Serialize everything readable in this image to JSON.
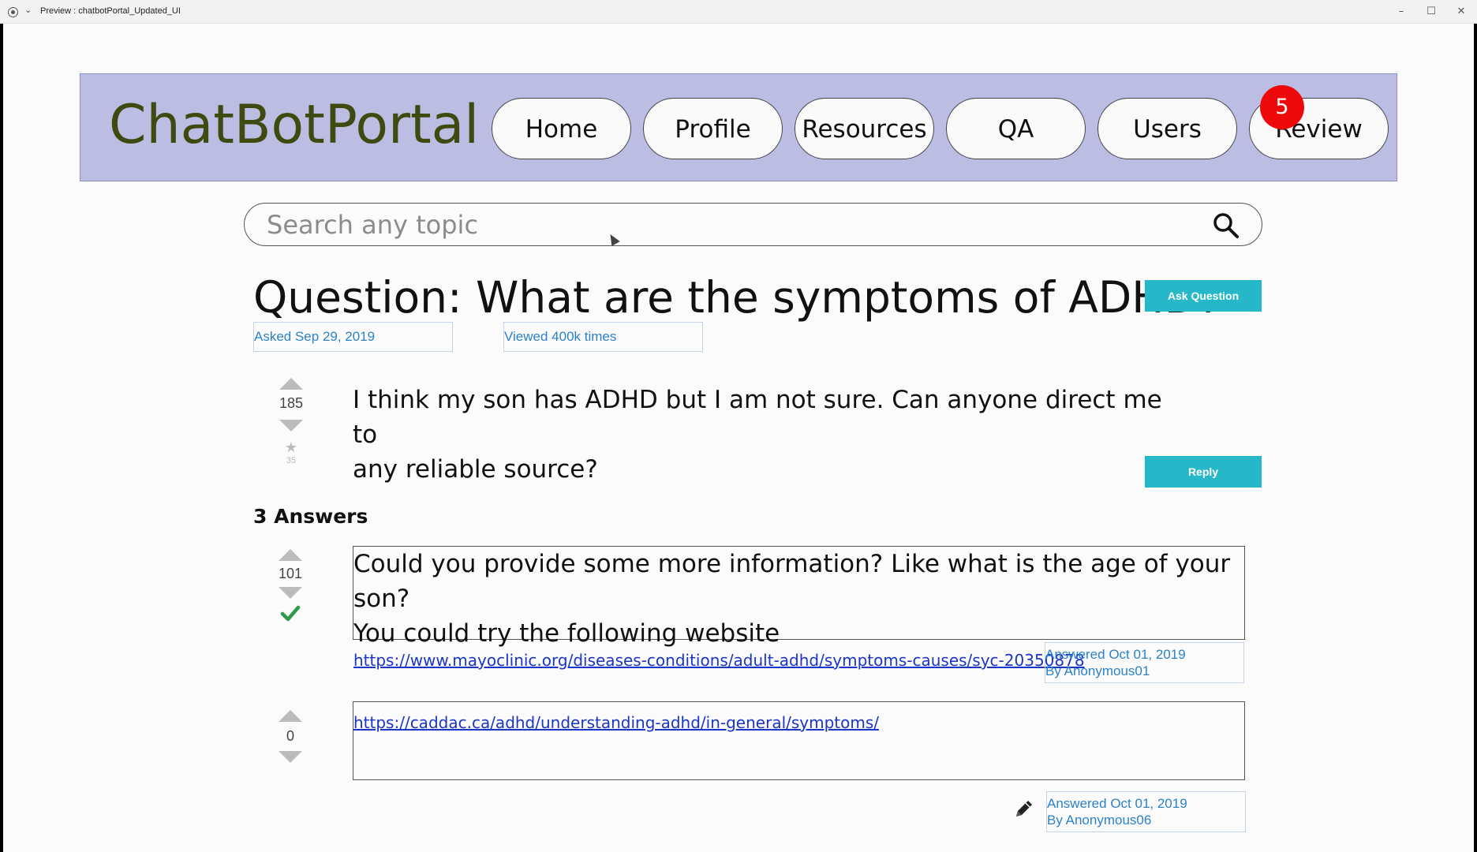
{
  "window": {
    "title": "Preview : chatbotPortal_Updated_UI",
    "minimize": "–",
    "maximize": "☐",
    "close": "✕"
  },
  "navbar": {
    "brand": "ChatBotPortal",
    "items": [
      {
        "label": "Home"
      },
      {
        "label": "Profile"
      },
      {
        "label": "Resources"
      },
      {
        "label": "QA"
      },
      {
        "label": "Users"
      },
      {
        "label": "Review"
      }
    ],
    "review_badge": "5",
    "background_color": "#bcbde3",
    "brand_color": "#3e4a10"
  },
  "search": {
    "placeholder": "Search any topic",
    "value": ""
  },
  "question": {
    "title": "Question: What are the symptoms of ADHD?",
    "asked": "Asked Sep 29, 2019",
    "viewed": "Viewed 400k times",
    "ask_button": "Ask Question",
    "votes": "185",
    "favorites": "35",
    "body_line1": "I think my son has ADHD but I am not sure. Can anyone direct me to",
    "body_line2": "any reliable source?",
    "reply_button": "Reply"
  },
  "answers": {
    "heading": "3 Answers",
    "list": [
      {
        "votes": "101",
        "accepted": true,
        "text_line1": "Could you provide some more information? Like what is the age of your son?",
        "text_line2": "You could try the following website",
        "link": "https://www.mayoclinic.org/diseases-conditions/adult-adhd/symptoms-causes/syc-20350878",
        "answered": "Answered Oct 01, 2019",
        "by": "By Anonymous01"
      },
      {
        "votes": "0",
        "accepted": false,
        "link": "https://caddac.ca/adhd/understanding-adhd/in-general/symptoms/",
        "answered": "Answered Oct 01, 2019",
        "by": "By Anonymous06"
      }
    ]
  },
  "colors": {
    "accent_teal": "#26b8c8",
    "meta_blue": "#2b82c9",
    "link_blue": "#1a35c8",
    "badge_red": "#ee0a0a",
    "check_green": "#2f9a4a"
  }
}
